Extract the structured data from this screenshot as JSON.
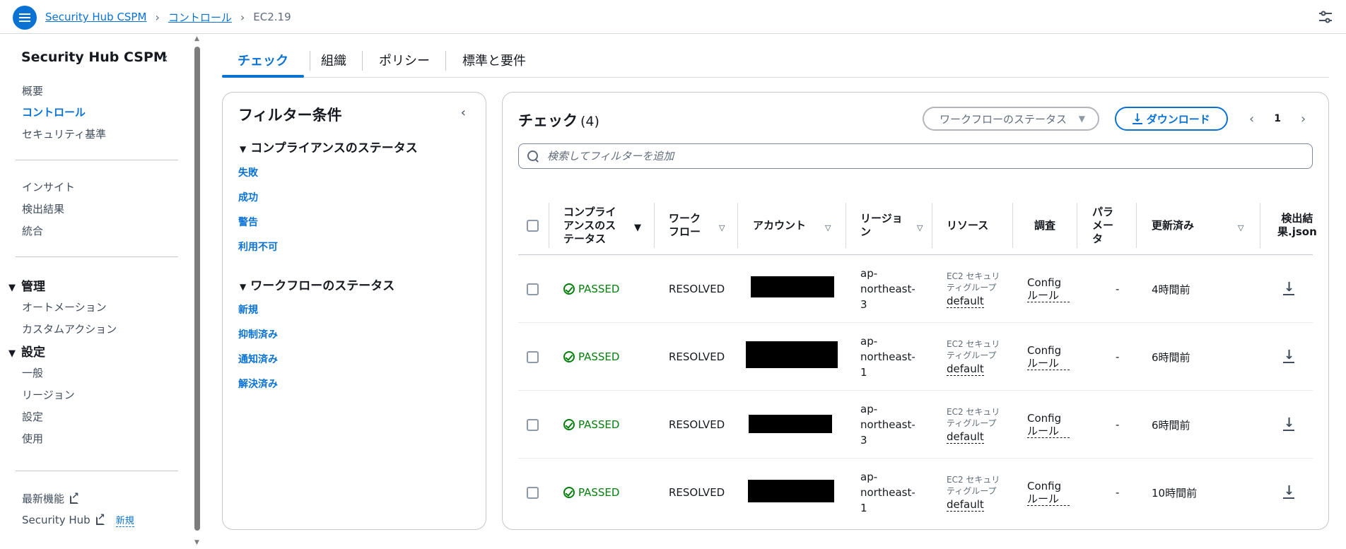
{
  "breadcrumb": {
    "service": "Security Hub CSPM",
    "section": "コントロール",
    "current": "EC2.19"
  },
  "sidebar": {
    "title": "Security Hub CSPM",
    "group1": [
      "概要",
      "コントロール",
      "セキュリティ基準"
    ],
    "active": "コントロール",
    "group2": [
      "インサイト",
      "検出結果",
      "統合"
    ],
    "section_manage": "管理",
    "manage_items": [
      "オートメーション",
      "カスタムアクション"
    ],
    "section_settings": "設定",
    "settings_items": [
      "一般",
      "リージョン",
      "設定",
      "使用"
    ],
    "footer_whats_new": "最新機能",
    "footer_security_hub": "Security Hub",
    "footer_new_badge": "新規"
  },
  "tabs": [
    "チェック",
    "組織",
    "ポリシー",
    "標準と要件"
  ],
  "filter": {
    "title": "フィルター条件",
    "compliance_heading": "コンプライアンスのステータス",
    "compliance_options": [
      "失敗",
      "成功",
      "警告",
      "利用不可"
    ],
    "workflow_heading": "ワークフローのステータス",
    "workflow_options": [
      "新規",
      "抑制済み",
      "通知済み",
      "解決済み"
    ]
  },
  "main": {
    "title": "チェック",
    "count": "(4)",
    "workflow_select_placeholder": "ワークフローのステータス",
    "download_label": "ダウンロード",
    "page": "1",
    "search_placeholder": "検索してフィルターを追加"
  },
  "table": {
    "columns": {
      "compliance": "コンプライアンスのステータス",
      "workflow": "ワークフロー",
      "account": "アカウント",
      "region": "リージョン",
      "resource": "リソース",
      "investigate": "調査",
      "parameters": "パラメータ",
      "updated": "更新済み",
      "finding_json": "検出結果.json"
    },
    "rows": [
      {
        "status": "PASSED",
        "workflow": "RESOLVED",
        "region": "ap-northeast-3",
        "resource_type": "EC2 セキュリティグループ",
        "resource_name": "default",
        "investigate": "Config ルール",
        "parameters": "-",
        "updated": "4時間前"
      },
      {
        "status": "PASSED",
        "workflow": "RESOLVED",
        "region": "ap-northeast-1",
        "resource_type": "EC2 セキュリティグループ",
        "resource_name": "default",
        "investigate": "Config ルール",
        "parameters": "-",
        "updated": "6時間前"
      },
      {
        "status": "PASSED",
        "workflow": "RESOLVED",
        "region": "ap-northeast-3",
        "resource_type": "EC2 セキュリティグループ",
        "resource_name": "default",
        "investigate": "Config ルール",
        "parameters": "-",
        "updated": "6時間前"
      },
      {
        "status": "PASSED",
        "workflow": "RESOLVED",
        "region": "ap-northeast-1",
        "resource_type": "EC2 セキュリティグループ",
        "resource_name": "default",
        "investigate": "Config ルール",
        "parameters": "-",
        "updated": "10時間前"
      }
    ]
  },
  "colors": {
    "accent": "#0972d3",
    "success": "#037f0c",
    "text": "#16191f",
    "muted": "#5f6b7a"
  },
  "icons": [
    "menu-icon",
    "chevron-right-icon",
    "settings-icon",
    "chevron-left-icon",
    "external-link-icon",
    "caret-down-icon",
    "download-icon",
    "search-icon",
    "check-circle-icon",
    "sort-icon"
  ]
}
